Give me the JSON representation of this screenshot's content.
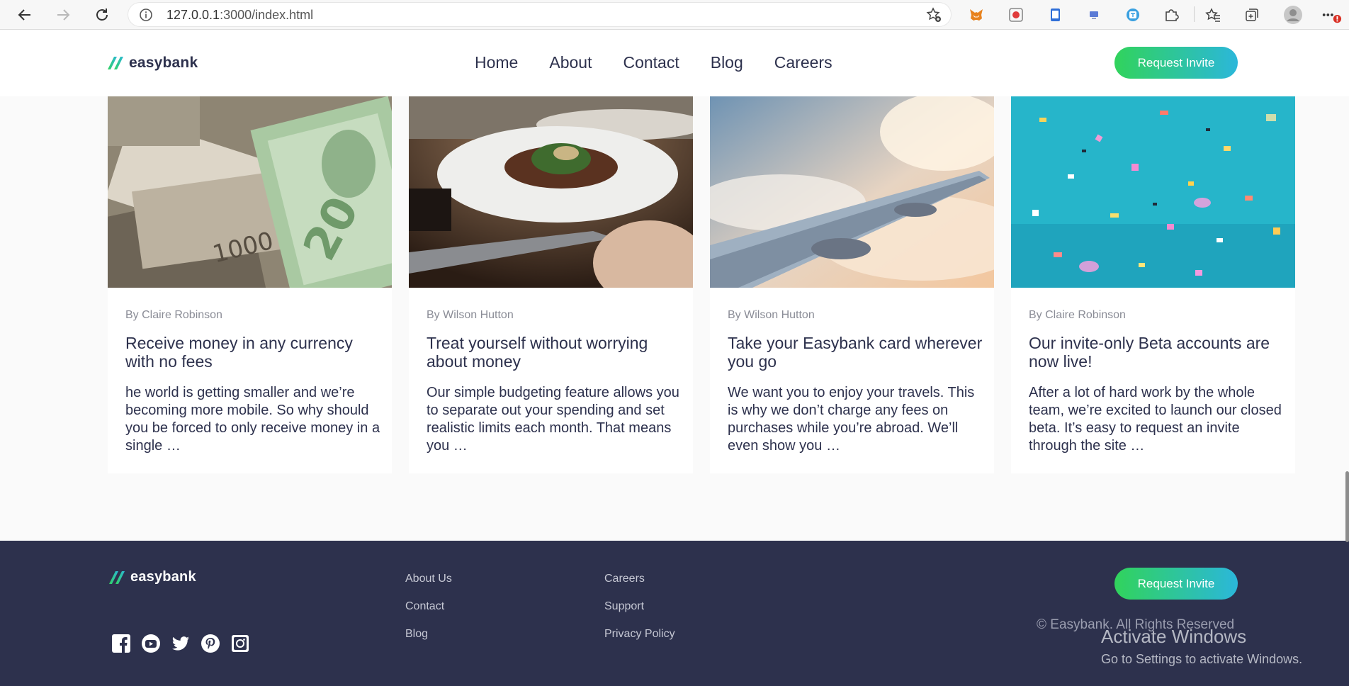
{
  "browser": {
    "url_host": "127.0.0.1",
    "url_rest": ":3000/index.html"
  },
  "header": {
    "logo_text": "easybank",
    "nav": [
      "Home",
      "About",
      "Contact",
      "Blog",
      "Careers"
    ],
    "cta_label": "Request Invite"
  },
  "articles": [
    {
      "author": "By Claire Robinson",
      "title": "Receive money in any currency with no fees",
      "excerpt": "he world is getting smaller and we’re becoming more mobile. So why should you be forced to only receive money in a single …",
      "image": "currency-banknotes"
    },
    {
      "author": "By Wilson Hutton",
      "title": "Treat yourself without worrying about money",
      "excerpt": "Our simple budgeting feature allows you to separate out your spending and set realistic limits each month. That means you …",
      "image": "restaurant-dish"
    },
    {
      "author": "By Wilson Hutton",
      "title": "Take your Easybank card wherever you go",
      "excerpt": "We want you to enjoy your travels. This is why we don’t charge any fees on purchases while you’re abroad. We’ll even show you …",
      "image": "airplane-wing"
    },
    {
      "author": "By Claire Robinson",
      "title": "Our invite-only Beta accounts are now live!",
      "excerpt": "After a lot of hard work by the whole team, we’re excited to launch our closed beta. It’s easy to request an invite through the site …",
      "image": "confetti"
    }
  ],
  "footer": {
    "logo_text": "easybank",
    "links_col1": [
      "About Us",
      "Contact",
      "Blog"
    ],
    "links_col2": [
      "Careers",
      "Support",
      "Privacy Policy"
    ],
    "social_icons": [
      "facebook-icon",
      "youtube-icon",
      "twitter-icon",
      "pinterest-icon",
      "instagram-icon"
    ],
    "cta_label": "Request Invite",
    "copyright": "© Easybank. All Rights Reserved"
  },
  "os_watermark": {
    "line1": "Activate Windows",
    "line2": "Go to Settings to activate Windows."
  },
  "colors": {
    "brand_navy": "#2d314d",
    "cta_green": "#31d35c",
    "cta_cyan": "#2bb7da"
  }
}
